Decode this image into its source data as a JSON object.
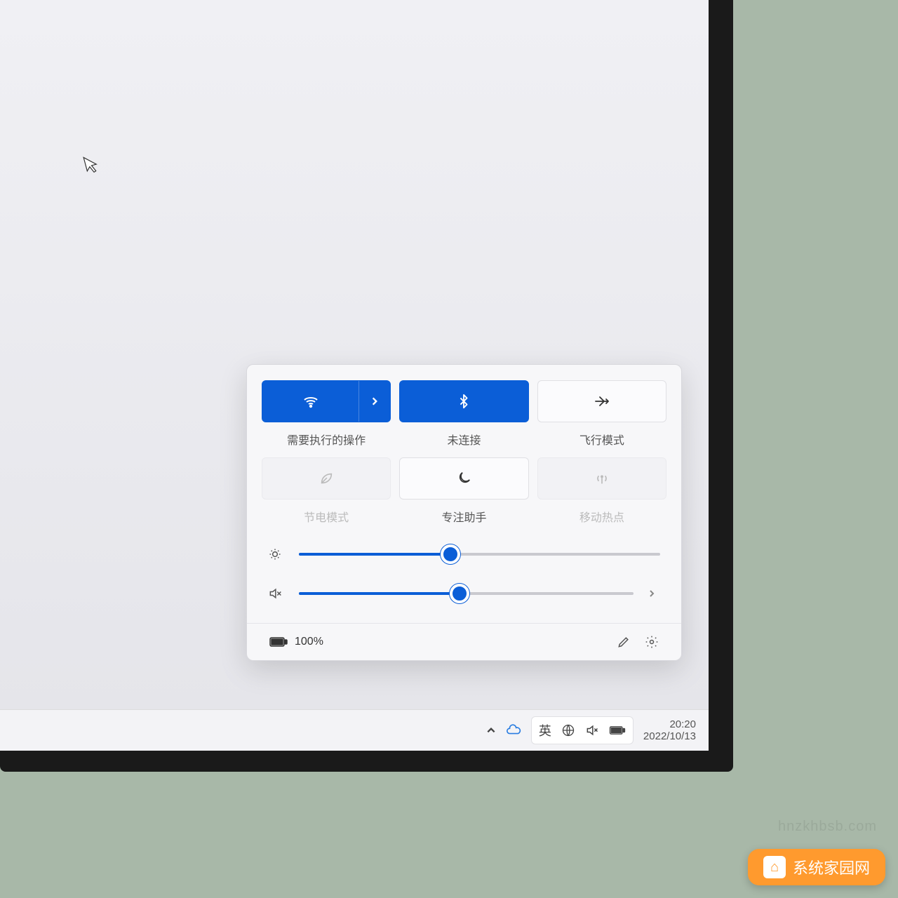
{
  "tiles": {
    "wifi": {
      "label": "需要执行的操作"
    },
    "bluetooth": {
      "label": "未连接"
    },
    "airplane": {
      "label": "飞行模式"
    },
    "battery": {
      "label": "节电模式"
    },
    "focus": {
      "label": "专注助手"
    },
    "hotspot": {
      "label": "移动热点"
    }
  },
  "sliders": {
    "brightness_pct": 42,
    "volume_pct": 48
  },
  "footer": {
    "battery_text": "100%"
  },
  "taskbar": {
    "ime_text": "英",
    "time": "20:20",
    "date": "2022/10/13"
  },
  "watermark": {
    "brand": "系统家园网",
    "url": "hnzkhbsb.com"
  }
}
